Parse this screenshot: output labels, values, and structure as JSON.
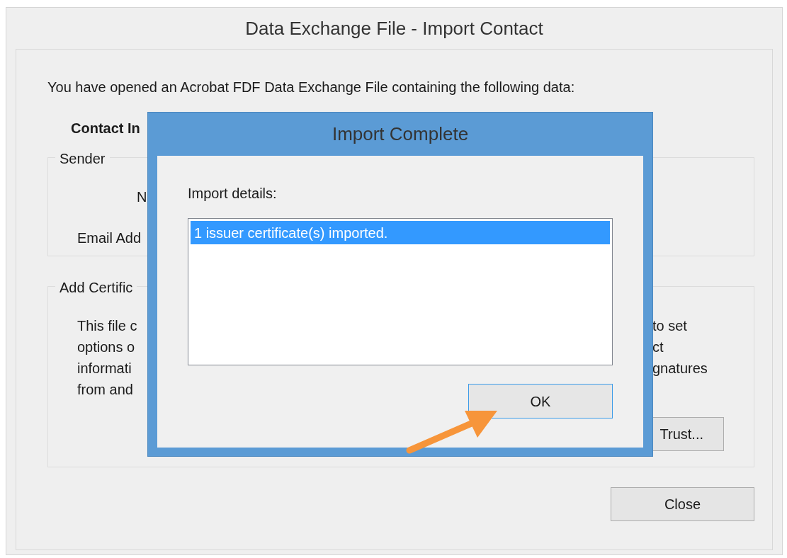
{
  "dialog": {
    "title": "Data Exchange File - Import Contact",
    "intro": "You have opened an Acrobat FDF Data Exchange File containing the following data:",
    "section_heading": "Contact In",
    "sender": {
      "legend": "Sender",
      "labels": [
        "N",
        "Email Add"
      ]
    },
    "certificate": {
      "legend": "Add Certific",
      "lines": [
        {
          "left": "This file c",
          "right": "to set"
        },
        {
          "left": "options o",
          "right": "ct"
        },
        {
          "left": "informati",
          "right": "gnatures"
        },
        {
          "left": "from and"
        }
      ],
      "trust_button": "Trust..."
    },
    "close_button": "Close"
  },
  "popup": {
    "title": "Import Complete",
    "label": "Import details:",
    "items": [
      {
        "text": "1 issuer certificate(s) imported.",
        "selected": true
      }
    ],
    "ok_button": "OK"
  }
}
